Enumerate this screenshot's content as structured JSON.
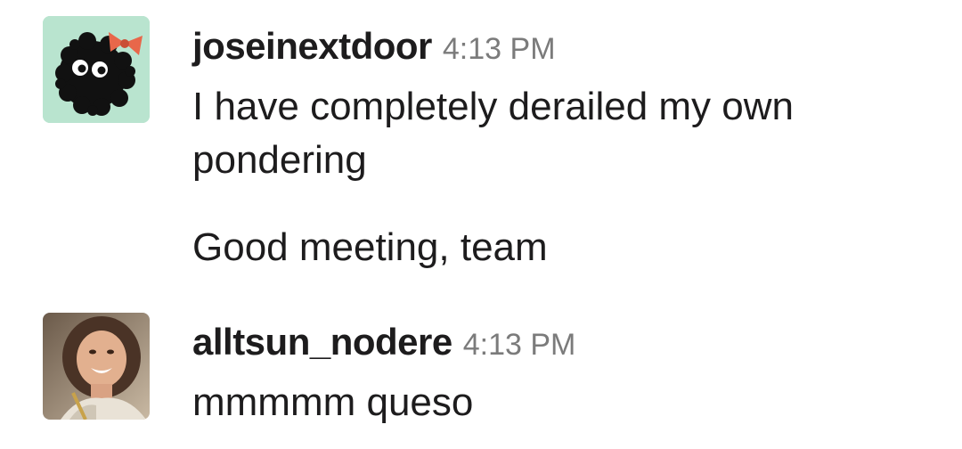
{
  "messages": [
    {
      "username": "joseinextdoor",
      "timestamp": "4:13 PM",
      "avatar_icon": "soot-sprite-with-bow-avatar",
      "avatar_bg": "#b9e4cf",
      "lines": [
        "I have completely derailed my own pondering",
        "Good meeting, team"
      ]
    },
    {
      "username": "alltsun_nodere",
      "timestamp": "4:13 PM",
      "avatar_icon": "smiling-woman-photo-avatar",
      "lines": [
        "mmmmm queso"
      ]
    }
  ],
  "colors": {
    "username": "#1d1c1d",
    "timestamp": "#7b7b7b",
    "bow": "#e8674a"
  }
}
